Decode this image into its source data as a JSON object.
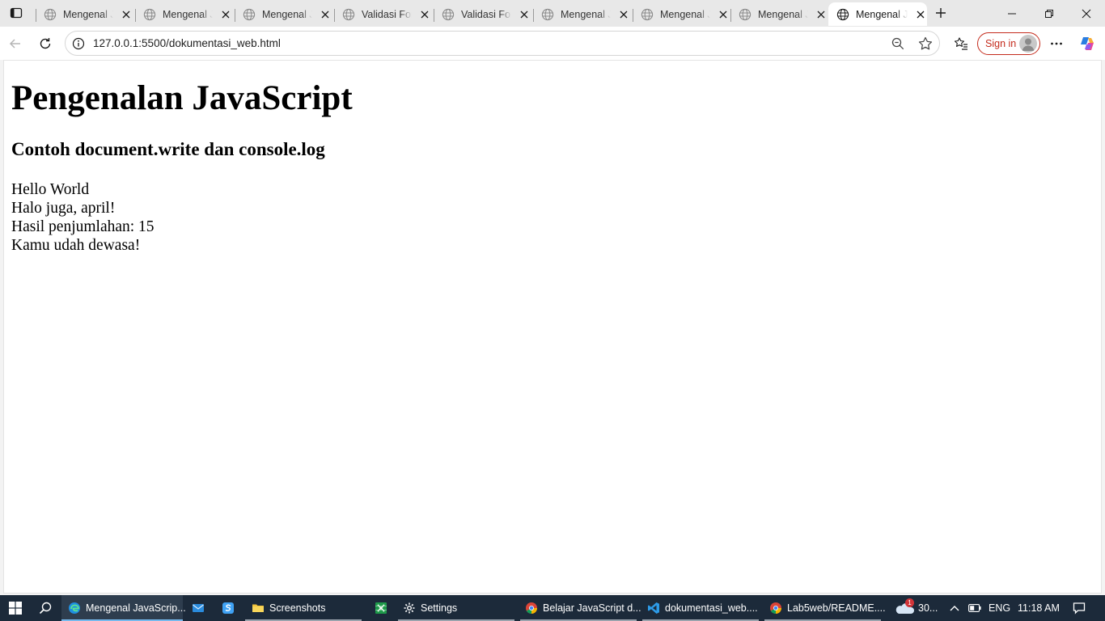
{
  "browser": {
    "tabs": [
      {
        "title": "Mengenal JavaScript",
        "active": false
      },
      {
        "title": "Mengenal JavaScript",
        "active": false
      },
      {
        "title": "Mengenal JavaScript",
        "active": false
      },
      {
        "title": "Validasi Form",
        "active": false
      },
      {
        "title": "Validasi Form",
        "active": false
      },
      {
        "title": "Mengenal JavaScript",
        "active": false
      },
      {
        "title": "Mengenal JavaScript",
        "active": false
      },
      {
        "title": "Mengenal JavaScript",
        "active": false
      },
      {
        "title": "Mengenal JavaScript",
        "active": true
      }
    ],
    "address_bar": {
      "url": "127.0.0.1:5500/dokumentasi_web.html"
    },
    "signin_label": "Sign in"
  },
  "page": {
    "heading": "Pengenalan JavaScript",
    "subheading": "Contoh document.write dan console.log",
    "lines": [
      "Hello World",
      "Halo juga, april!",
      "Hasil penjumlahan: 15",
      "Kamu udah dewasa!"
    ]
  },
  "taskbar": {
    "items": [
      {
        "label": "Mengenal JavaScrip...",
        "icon": "edge-icon",
        "active": true
      },
      {
        "label": "",
        "icon": "mail-icon",
        "active": false
      },
      {
        "label": "",
        "icon": "app-icon",
        "active": false
      },
      {
        "label": "Screenshots",
        "icon": "folder-icon",
        "active": false
      },
      {
        "label": "",
        "icon": "spreadsheet-icon",
        "active": false
      },
      {
        "label": "Settings",
        "icon": "gear-icon",
        "active": false
      },
      {
        "label": "Belajar JavaScript d...",
        "icon": "chrome-icon",
        "active": false
      },
      {
        "label": "dokumentasi_web....",
        "icon": "vscode-icon",
        "active": false
      },
      {
        "label": "Lab5web/README....",
        "icon": "chrome-icon",
        "active": false
      }
    ],
    "weather": "30...",
    "weather_badge": "1",
    "language": "ENG",
    "time": "11:18 AM"
  },
  "colors": {
    "accent": "#76b9ed",
    "signin": "#c42b1c",
    "taskbar": "#1c2a3a"
  }
}
